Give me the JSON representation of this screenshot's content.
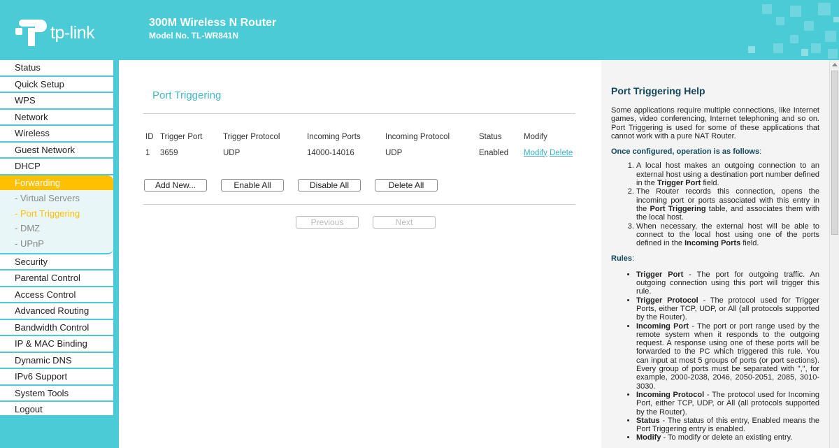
{
  "header": {
    "logo_text": "tp-link",
    "title": "300M Wireless N Router",
    "model": "Model No. TL-WR841N"
  },
  "sidebar": {
    "items_top": [
      {
        "label": "Status"
      },
      {
        "label": "Quick Setup"
      },
      {
        "label": "WPS"
      },
      {
        "label": "Network"
      },
      {
        "label": "Wireless"
      },
      {
        "label": "Guest Network"
      },
      {
        "label": "DHCP"
      },
      {
        "label": "Forwarding"
      }
    ],
    "sub_items": [
      {
        "label": "- Virtual Servers"
      },
      {
        "label": "- Port Triggering"
      },
      {
        "label": "- DMZ"
      },
      {
        "label": "- UPnP"
      }
    ],
    "items_bottom": [
      {
        "label": "Security"
      },
      {
        "label": "Parental Control"
      },
      {
        "label": "Access Control"
      },
      {
        "label": "Advanced Routing"
      },
      {
        "label": "Bandwidth Control"
      },
      {
        "label": "IP & MAC Binding"
      },
      {
        "label": "Dynamic DNS"
      },
      {
        "label": "IPv6 Support"
      },
      {
        "label": "System Tools"
      },
      {
        "label": "Logout"
      }
    ]
  },
  "main": {
    "title": "Port Triggering",
    "columns": [
      "ID",
      "Trigger Port",
      "Trigger Protocol",
      "Incoming Ports",
      "Incoming Protocol",
      "Status",
      "Modify"
    ],
    "rows": [
      {
        "id": "1",
        "trigger_port": "3659",
        "trigger_protocol": "UDP",
        "incoming_ports": "14000-14016",
        "incoming_protocol": "UDP",
        "status": "Enabled",
        "modify": "Modify",
        "delete": "Delete"
      }
    ],
    "buttons": {
      "add_new": "Add New...",
      "enable_all": "Enable All",
      "disable_all": "Disable All",
      "delete_all": "Delete All",
      "previous": "Previous",
      "next": "Next"
    }
  },
  "help": {
    "title": "Port Triggering Help",
    "intro": "Some applications require multiple connections, like Internet games, video conferencing, Internet telephoning and so on. Port Triggering is used for some of these applications that cannot work with a pure NAT Router.",
    "once_heading": "Once configured, operation is as follows",
    "steps": [
      {
        "pre": "A local host makes an outgoing connection to an external host using a destination port number defined in the ",
        "bold": "Trigger Port",
        "post": " field."
      },
      {
        "pre": "The Router records this connection, opens the incoming port or ports associated with this entry in the ",
        "bold": "Port Triggering",
        "post": " table, and associates them with the local host."
      },
      {
        "pre": "When necessary, the external host will be able to connect to the local host using one of the ports defined in the ",
        "bold": "Incoming Ports",
        "post": " field."
      }
    ],
    "rules_heading": "Rules",
    "rules": [
      {
        "term": "Trigger Port",
        "text": " - The port for outgoing traffic. An outgoing connection using this port will trigger this rule."
      },
      {
        "term": "Trigger Protocol",
        "text": " - The protocol used for Trigger Ports, either TCP, UDP, or All (all protocols supported by the Router)."
      },
      {
        "term": "Incoming Port",
        "text": " - The port or port range used by the remote system when it responds to the outgoing request. A response using one of these ports will be forwarded to the PC which triggered this rule. You can input at most 5 groups of ports (or port sections). Every group of ports must be separated with \",\", for example, 2000-2038, 2046, 2050-2051, 2085, 3010-3030."
      },
      {
        "term": "Incoming Protocol",
        "text": " - The protocol used for Incoming Port, either TCP, UDP, or All (all protocols supported by the Router)."
      },
      {
        "term": "Status",
        "text": " - The status of this entry, Enabled means the Port Triggering entry is enabled."
      },
      {
        "term": "Modify",
        "text": " - To modify or delete an existing entry."
      }
    ]
  },
  "colors": {
    "header_bg": "#4acbd6",
    "active_nav": "#ffc000",
    "link": "#3ab0c4",
    "help_heading": "#12475a"
  }
}
